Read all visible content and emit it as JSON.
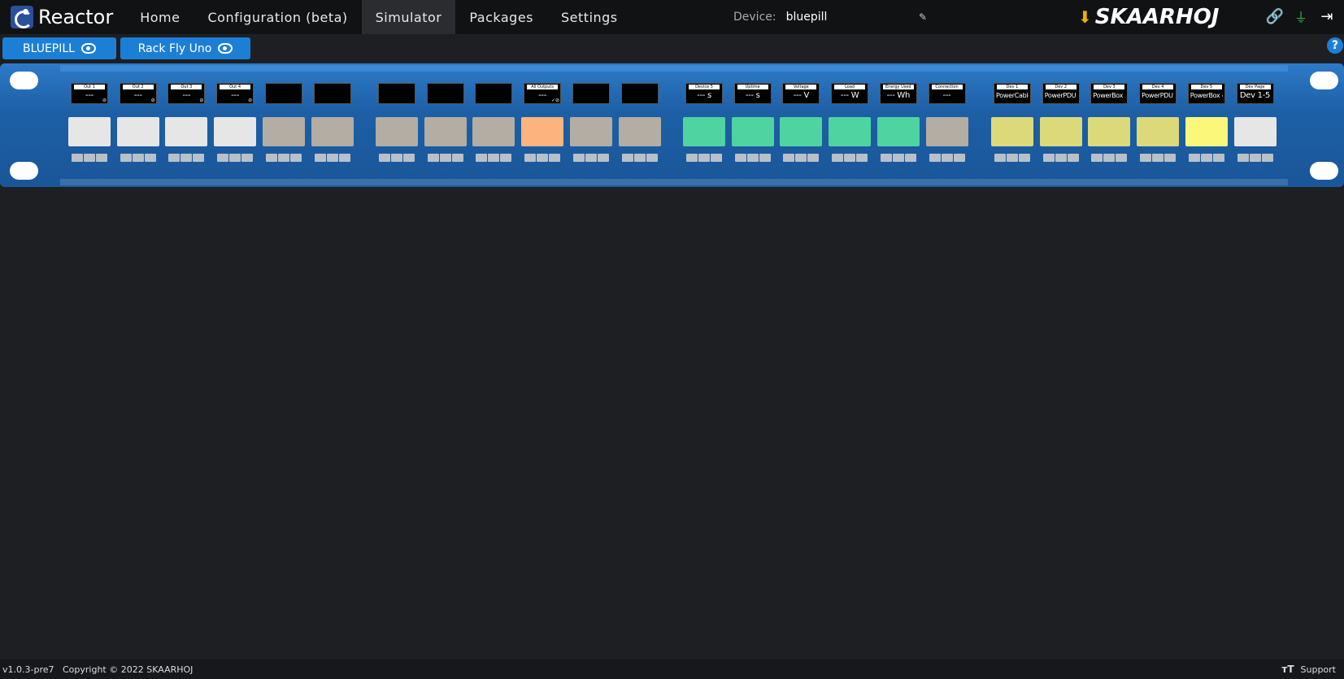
{
  "app": {
    "title": "Reactor"
  },
  "nav": [
    {
      "label": "Home",
      "active": false
    },
    {
      "label": "Configuration (beta)",
      "active": false
    },
    {
      "label": "Simulator",
      "active": true
    },
    {
      "label": "Packages",
      "active": false
    },
    {
      "label": "Settings",
      "active": false
    }
  ],
  "device": {
    "label": "Device:",
    "value": "bluepill"
  },
  "brand": {
    "name": "SKAARHOJ"
  },
  "panel_tabs": [
    {
      "label": "BLUEPILL"
    },
    {
      "label": "Rack Fly Uno"
    }
  ],
  "help": {
    "label": "?"
  },
  "displays": [
    {
      "title": "Out 1",
      "value": "---",
      "mark": "⊘"
    },
    {
      "title": "Out 2",
      "value": "---",
      "mark": "⊘"
    },
    {
      "title": "Out 3",
      "value": "---",
      "mark": "⊘"
    },
    {
      "title": "Out 4",
      "value": "---",
      "mark": "⊘"
    },
    {
      "title": "",
      "value": "",
      "mark": ""
    },
    {
      "title": "",
      "value": "",
      "mark": ""
    },
    {
      "title": "",
      "value": "",
      "mark": ""
    },
    {
      "title": "",
      "value": "",
      "mark": ""
    },
    {
      "title": "",
      "value": "",
      "mark": ""
    },
    {
      "title": "All Outputs",
      "value": "---",
      "mark": "✓⊘"
    },
    {
      "title": "",
      "value": "",
      "mark": ""
    },
    {
      "title": "",
      "value": "",
      "mark": ""
    },
    {
      "title": "Device 5",
      "value": "--- s",
      "mark": ""
    },
    {
      "title": "Uptime",
      "value": "--- s",
      "mark": ""
    },
    {
      "title": "Voltage",
      "value": "--- V",
      "mark": ""
    },
    {
      "title": "Load",
      "value": "--- W",
      "mark": ""
    },
    {
      "title": "Energy Used",
      "value": "--- Wh",
      "mark": ""
    },
    {
      "title": "Connection",
      "value": "---",
      "mark": ""
    },
    {
      "title": "Dev 1",
      "value": "PowerCable+",
      "mark": ""
    },
    {
      "title": "Dev 2",
      "value": "PowerPDU 4C",
      "mark": ""
    },
    {
      "title": "Dev 3",
      "value": "PowerBox 3P",
      "mark": ""
    },
    {
      "title": "Dev 4",
      "value": "PowerPDU 8D",
      "mark": ""
    },
    {
      "title": "Dev 5",
      "value": "PowerBox 4K",
      "mark": ""
    },
    {
      "title": "Dev Page",
      "value": "Dev 1-5",
      "mark": ""
    }
  ],
  "key_colors": [
    "#e6e6e6",
    "#e6e6e6",
    "#e6e6e6",
    "#e6e6e6",
    "#b3ada3",
    "#b3ada3",
    "#b3ada3",
    "#b3ada3",
    "#b3ada3",
    "#fdb37e",
    "#b3ada3",
    "#b3ada3",
    "#4fd3a1",
    "#4fd3a1",
    "#4fd3a1",
    "#4fd3a1",
    "#4fd3a1",
    "#b3ada3",
    "#dcd97a",
    "#dcd97a",
    "#dcd97a",
    "#dcd97a",
    "#fbf77a",
    "#e6e6e6"
  ],
  "footer": {
    "version": "v1.0.3-pre7",
    "copyright": "Copyright © 2022 SKAARHOJ",
    "support": "Support"
  }
}
